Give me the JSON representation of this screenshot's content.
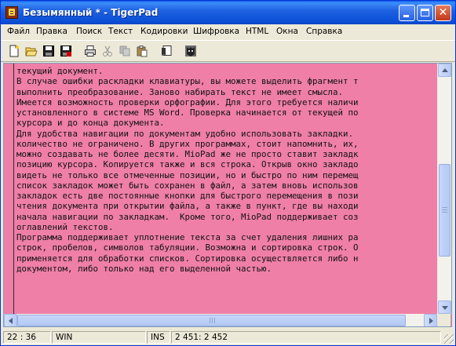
{
  "window": {
    "title": "Безымянный * - TigerPad"
  },
  "menu": [
    "Файл",
    "Правка",
    "Поиск",
    "Текст",
    "Кодировки",
    "Шифровка",
    "HTML",
    "Окна",
    "Справка"
  ],
  "toolbar": {
    "icons": [
      "new-file-icon",
      "open-folder-icon",
      "save-icon",
      "save-all-icon",
      "print-icon",
      "cut-icon",
      "copy-icon",
      "paste-icon",
      "bookmark-icon",
      "tiger-icon"
    ]
  },
  "editor": {
    "background": "#ef7fa7",
    "lines": [
      "текущий документ.",
      "В случае ошибки раскладки клавиатуры, вы можете выделить фрагмент т",
      "выполнить преобразование. Заново набирать текст не имеет смысла.",
      "Имеется возможность проверки орфографии. Для этого требуется наличи",
      "установленного в системе MS Word. Проверка начинается от текущей по",
      "курсора и до конца документа.",
      "Для удобства навигации по документам удобно использовать закладки.",
      "количество не ограничено. В других программах, стоит напомнить, их,",
      "можно создавать не более десяти. MioPad же не просто ставит закладк",
      "позицию курсора. Копируется также и вся строка. Открыв окно закладо",
      "видеть не только все отмеченные позиции, но и быстро по ним перемещ",
      "список закладок может быть сохранен в файл, а затем вновь использов",
      "закладок есть две постоянные кнопки для быстрого перемещения в пози",
      "чтения документа при открытии файла, а также в пункт, где вы находи",
      "начала навигации по закладкам.  Кроме того, MioPad поддерживает соз",
      "оглавлений текстов.",
      "Программа поддерживает уплотнение текста за счет удаления лишних ра",
      "строк, пробелов, символов табуляции. Возможна и сортировка строк. О",
      "применяется для обработки списков. Сортировка осуществляется либо н",
      "документом, либо только над его выделенной частью.",
      ""
    ]
  },
  "status": {
    "position": "22 : 36",
    "encoding": "WIN",
    "mode": "INS",
    "counts": "2 451: 2 452"
  }
}
